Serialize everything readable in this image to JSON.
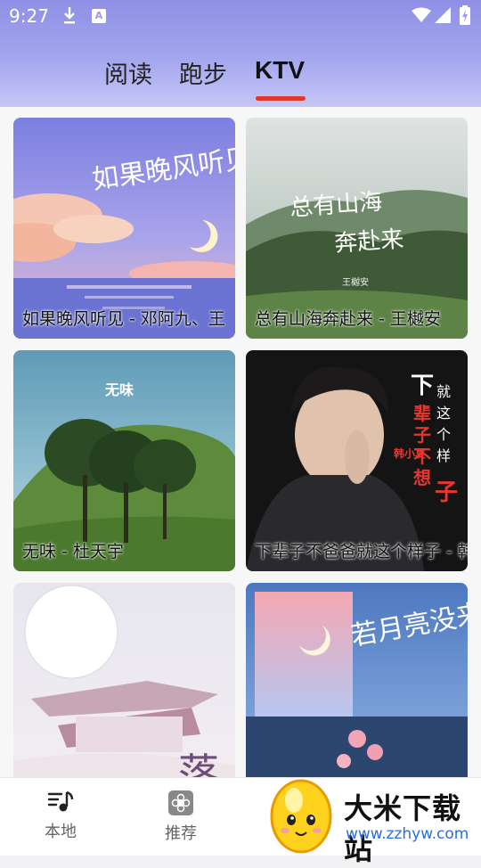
{
  "status_bar": {
    "time": "9:27"
  },
  "tabs": [
    {
      "label": "阅读",
      "active": false
    },
    {
      "label": "跑步",
      "active": false
    },
    {
      "label": "KTV",
      "active": true
    }
  ],
  "accent_color": "#e6372d",
  "cards": [
    {
      "caption": "如果晚风听见 - 邓阿九、王",
      "art_title": "如果晚风听见"
    },
    {
      "caption": "总有山海奔赴来 - 王樾安",
      "art_title": "总有山海奔赴来",
      "art_artist": "王樾安"
    },
    {
      "caption": "无味 - 杜天宇",
      "art_title": "无味"
    },
    {
      "caption": "下辈子不爸爸就这个样子 - 韩小",
      "art_title_right": [
        "就",
        "这",
        "个",
        "样",
        "子"
      ],
      "art_title_left": [
        "下",
        "辈",
        "子",
        "不",
        "想"
      ],
      "art_artist": "韩小夏"
    },
    {
      "caption": "",
      "art_title": "落"
    },
    {
      "caption": "",
      "art_title": "若月亮没来"
    }
  ],
  "bottom_nav": [
    {
      "label": "本地",
      "icon": "music-note-icon"
    },
    {
      "label": "推荐",
      "icon": "flower-icon"
    }
  ],
  "watermark": {
    "title": "大米下载站",
    "url": "www.zzhyw.com"
  }
}
